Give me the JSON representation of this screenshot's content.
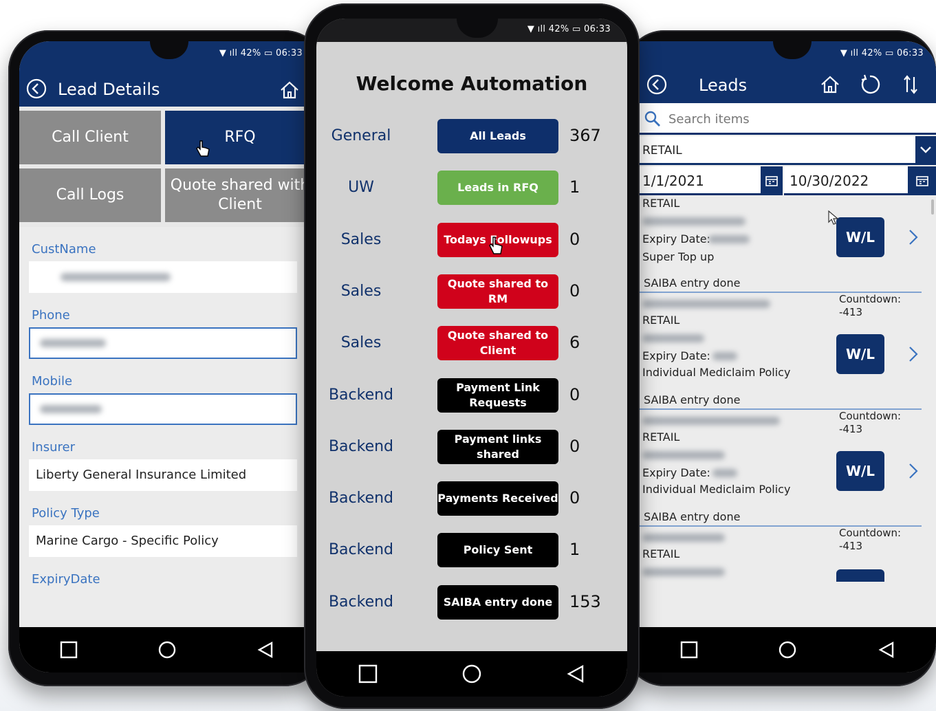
{
  "status": {
    "battery": "42%",
    "time": "06:33"
  },
  "lead_details": {
    "title": "Lead Details",
    "tabs": [
      {
        "label": "Call Client"
      },
      {
        "label": "RFQ"
      },
      {
        "label": "Call Logs"
      },
      {
        "label": "Quote shared with Client"
      }
    ],
    "fields": {
      "custname_label": "CustName",
      "phone_label": "Phone",
      "mobile_label": "Mobile",
      "insurer_label": "Insurer",
      "insurer_value": "Liberty General Insurance Limited",
      "policy_type_label": "Policy Type",
      "policy_type_value": "Marine Cargo - Specific Policy",
      "expiry_label": "ExpiryDate"
    }
  },
  "dashboard": {
    "title": "Welcome Automation",
    "rows": [
      {
        "team": "General",
        "button": "All Leads",
        "count": "367",
        "color": "#0e2f6b"
      },
      {
        "team": "UW",
        "button": "Leads in RFQ",
        "count": "1",
        "color": "#6ab04c"
      },
      {
        "team": "Sales",
        "button": "Todays Followups",
        "count": "0",
        "color": "#d0021b"
      },
      {
        "team": "Sales",
        "button": "Quote shared to RM",
        "count": "0",
        "color": "#d0021b"
      },
      {
        "team": "Sales",
        "button": "Quote shared to Client",
        "count": "6",
        "color": "#d0021b"
      },
      {
        "team": "Backend",
        "button": "Payment Link Requests",
        "count": "0",
        "color": "#000000"
      },
      {
        "team": "Backend",
        "button": "Payment links shared",
        "count": "0",
        "color": "#000000"
      },
      {
        "team": "Backend",
        "button": "Payments Received",
        "count": "0",
        "color": "#000000"
      },
      {
        "team": "Backend",
        "button": "Policy Sent",
        "count": "1",
        "color": "#000000"
      },
      {
        "team": "Backend",
        "button": "SAIBA entry done",
        "count": "153",
        "color": "#000000"
      }
    ]
  },
  "leads": {
    "title": "Leads",
    "search_placeholder": "Search items",
    "segment": "RETAIL",
    "date_from": "1/1/2021",
    "date_to": "10/30/2022",
    "cards": [
      {
        "segment": "RETAIL",
        "expiry_label": "Expiry Date:",
        "product": "Super Top up",
        "status": "SAIBA entry done",
        "badge": "W/L",
        "countdown_label": "Countdown:",
        "countdown_value": "-413"
      },
      {
        "segment": "RETAIL",
        "expiry_label": "Expiry Date:",
        "product": "Individual Mediclaim Policy",
        "status": "SAIBA entry done",
        "badge": "W/L",
        "countdown_label": "Countdown:",
        "countdown_value": "-413"
      },
      {
        "segment": "RETAIL",
        "expiry_label": "Expiry Date:",
        "product": "Individual Mediclaim Policy",
        "status": "SAIBA entry done",
        "badge": "W/L",
        "countdown_label": "Countdown:",
        "countdown_value": "-413"
      },
      {
        "segment": "RETAIL"
      }
    ]
  },
  "icons": [
    "back-icon",
    "home-icon",
    "refresh-icon",
    "sort-icon",
    "search-icon",
    "chevron-down-icon",
    "calendar-icon",
    "chevron-right-icon",
    "square-nav-icon",
    "circle-nav-icon",
    "triangle-back-nav-icon",
    "hand-cursor-icon",
    "arrow-cursor-icon"
  ],
  "colors": {
    "navy": "#10316b",
    "accent_blue": "#3a73c0",
    "green": "#6ab04c",
    "red": "#d0021b"
  }
}
